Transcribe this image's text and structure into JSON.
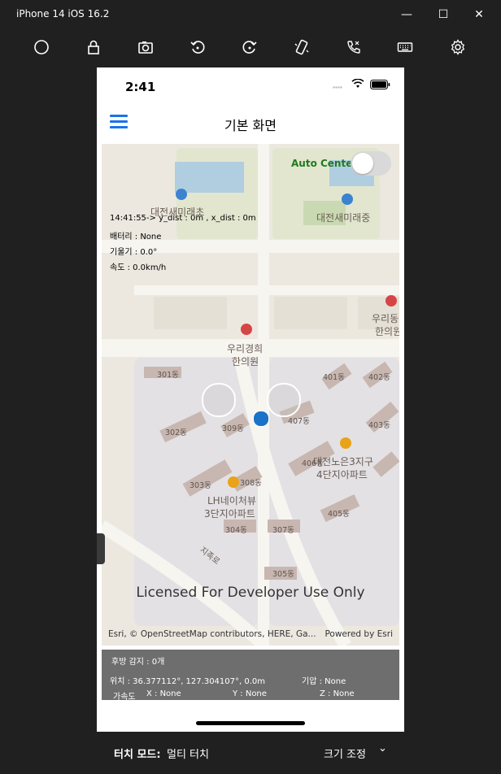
{
  "window": {
    "title": "iPhone 14 iOS 16.2",
    "controls": {
      "minimize": "—",
      "maximize": "☐",
      "close": "✕"
    }
  },
  "toolbar": {
    "icons": [
      "home-icon",
      "lock-icon",
      "screenshot-icon",
      "rotate-left-icon",
      "rotate-right-icon",
      "shake-icon",
      "call-icon",
      "keyboard-icon",
      "settings-icon"
    ]
  },
  "phone": {
    "status_time": "2:41",
    "nav_title": "기본 화면"
  },
  "map": {
    "auto_center_label": "Auto Center",
    "auto_center_on": false,
    "info_line1": "14:41:55-> y_dist : 0m , x_dist : 0m",
    "battery": "배터리 : None",
    "tilt": "기울기 : 0.0°",
    "speed": "속도 : 0.0km/h",
    "poi_elementary": "대전새미래초",
    "poi_middle": "대전새미래중",
    "poi_clinic_line1": "우리경희",
    "poi_clinic_line2": "한의원",
    "poi_clinic2_line1": "우리동",
    "poi_clinic2_line2": "한의원",
    "poi_apt1_line1": "LH네이처뷰",
    "poi_apt1_line2": "3단지아파트",
    "poi_apt2_line1": "대전노은3지구",
    "poi_apt2_line2": "4단지아파트",
    "road_label": "지족로",
    "buildings": [
      "301동",
      "401동",
      "402동",
      "407동",
      "403동",
      "309동",
      "302동",
      "406동",
      "303동",
      "308동",
      "304동",
      "307동",
      "405동",
      "305동"
    ],
    "licensed": "Licensed For Developer Use Only",
    "attribution": "Esri, © OpenStreetMap contributors, HERE, Ga...",
    "powered": "Powered by Esri"
  },
  "panel": {
    "rear_detect": "후방 감지 : 0개",
    "position": "위치 :  36.377112°, 127.304107°, 0.0m",
    "pressure": "기압 :  None",
    "accel_label": "가속도",
    "accel_x": "X :  None",
    "accel_y": "Y :  None",
    "accel_z": "Z :  None"
  },
  "footer": {
    "touch_mode_label": "터치 모드:",
    "touch_mode_value": "멀티 터치",
    "resize_label": "크기 조정",
    "resize_chevron": "⌄"
  },
  "colors": {
    "window_bg": "#202020",
    "accent_blue": "#1a73e8",
    "auto_center_green": "#1e7b1e",
    "panel_bg": "#6e6e6e"
  }
}
